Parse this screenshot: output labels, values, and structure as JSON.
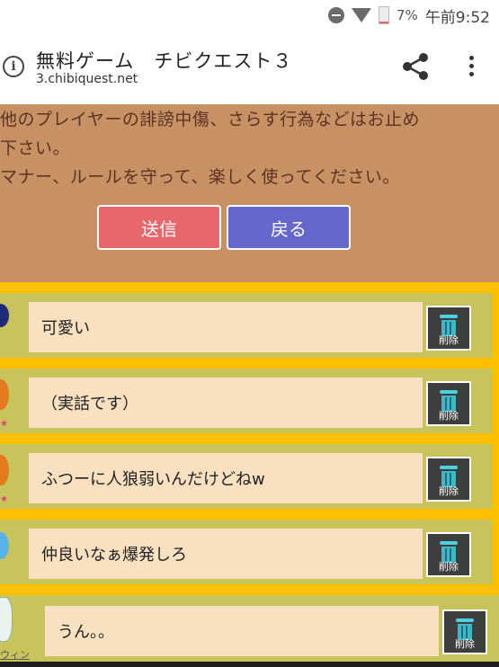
{
  "status_bar": {
    "battery_percent": "7%",
    "time": "午前9:52",
    "icons": [
      "do-not-disturb-icon",
      "wifi-icon",
      "battery-icon"
    ]
  },
  "browser": {
    "title": "無料ゲーム　チビクエスト３",
    "url": "3.chibiquest.net",
    "icons": [
      "info-icon",
      "share-icon",
      "overflow-menu-icon"
    ]
  },
  "notice": {
    "lines": [
      "他のプレイヤーの誹謗中傷、さらす行為などはお止め",
      "下さい。",
      "マナー、ルールを守って、楽しく使ってください。"
    ],
    "send_label": "送信",
    "back_label": "戻る"
  },
  "comments": [
    {
      "text": "可愛い",
      "delete_label": "削除"
    },
    {
      "text": "（実話です）",
      "delete_label": "削除"
    },
    {
      "text": "ふつーに人狼弱いんだけどねw",
      "delete_label": "削除"
    },
    {
      "text": "仲良いなぁ爆発しろ",
      "delete_label": "削除"
    },
    {
      "text": "うん。。",
      "delete_label": "削除",
      "username": "ウィン"
    }
  ],
  "colors": {
    "notice_bg": "#c89163",
    "notice_text": "#5a3323",
    "send_button": "#e7676c",
    "back_button": "#6567cc",
    "list_bg": "#ffc000",
    "row_bg": "#c9c35c",
    "bubble_bg": "#f8e0c0"
  }
}
